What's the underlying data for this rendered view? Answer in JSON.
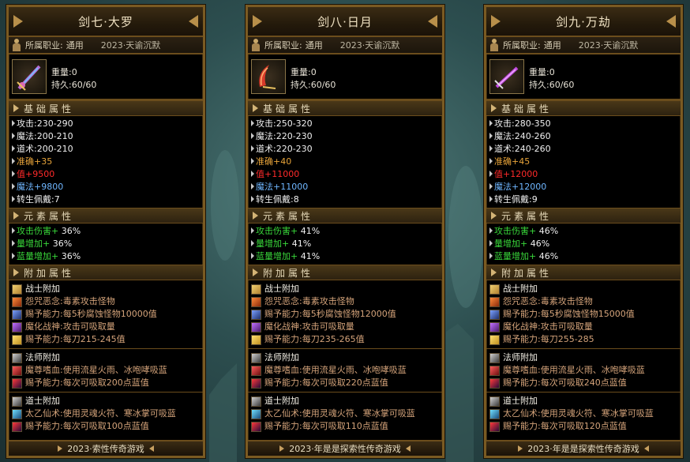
{
  "panels": [
    {
      "title": "剑七·大罗",
      "job_label": "所属职业:",
      "job_value": "通用",
      "season": "2023·天谕沉默",
      "weight": "重量:0",
      "durability": "持久:60/60",
      "sec_basic": "基础属性",
      "basic": [
        "攻击:230-290",
        "魔法:200-210",
        "道术:200-210"
      ],
      "accuracy": "准确+35",
      "hp": "值+9500",
      "mp_label": "魔法",
      "mp_value": "+9800",
      "reborn": "转生佩戴:7",
      "sec_element": "元素属性",
      "elements": [
        {
          "label": "攻击伤害+",
          "value": "36%"
        },
        {
          "label": "量增加+",
          "value": "36%"
        },
        {
          "label": "蓝量增加+",
          "value": "36%"
        }
      ],
      "sec_extra": "附加属性",
      "warrior": {
        "head": "战士附加",
        "lines": [
          "怨咒恶念:毒素攻击怪物",
          "赐予能力:每5秒腐蚀怪物10000值",
          "魔化战神:攻击可吸取量",
          "赐予能力:每刀215-245值"
        ]
      },
      "mage": {
        "head": "法师附加",
        "lines": [
          "魔尊嗜血:使用流星火雨、冰咆哮吸蓝",
          "赐予能力:每次可吸取200点蓝值"
        ]
      },
      "taoist": {
        "head": "道士附加",
        "lines": [
          "太乙仙术:使用灵魂火符、寒冰掌可吸蓝",
          "赐予能力:每次可吸取100点蓝值"
        ]
      },
      "footer": "2023·索性传奇游戏"
    },
    {
      "title": "剑八·日月",
      "job_label": "所属职业:",
      "job_value": "通用",
      "season": "2023·天谕沉默",
      "weight": "重量:0",
      "durability": "持久:60/60",
      "sec_basic": "基础属性",
      "basic": [
        "攻击:250-320",
        "魔法:220-230",
        "道术:220-230"
      ],
      "accuracy": "准确+40",
      "hp": "值+11000",
      "mp_label": "魔法",
      "mp_value": "+11000",
      "reborn": "转生佩戴:8",
      "sec_element": "元素属性",
      "elements": [
        {
          "label": "攻击伤害+",
          "value": "41%"
        },
        {
          "label": "量增加+",
          "value": "41%"
        },
        {
          "label": "蓝量增加+",
          "value": "41%"
        }
      ],
      "sec_extra": "附加属性",
      "warrior": {
        "head": "战士附加",
        "lines": [
          "怨咒恶念:毒素攻击怪物",
          "赐予能力:每5秒腐蚀怪物12000值",
          "魔化战神:攻击可吸取量",
          "赐予能力:每刀235-265值"
        ]
      },
      "mage": {
        "head": "法师附加",
        "lines": [
          "魔尊嗜血:使用流星火雨、冰咆哮吸蓝",
          "赐予能力:每次可吸取220点蓝值"
        ]
      },
      "taoist": {
        "head": "道士附加",
        "lines": [
          "太乙仙术:使用灵魂火符、寒冰掌可吸蓝",
          "赐予能力:每次可吸取110点蓝值"
        ]
      },
      "footer": "2023·年是是探索性传奇游戏"
    },
    {
      "title": "剑九·万劫",
      "job_label": "所属职业:",
      "job_value": "通用",
      "season": "2023·天谕沉默",
      "weight": "重量:0",
      "durability": "持久:60/60",
      "sec_basic": "基础属性",
      "basic": [
        "攻击:280-350",
        "魔法:240-260",
        "道术:240-260"
      ],
      "accuracy": "准确+45",
      "hp": "值+12000",
      "mp_label": "魔法",
      "mp_value": "+12000",
      "reborn": "转生佩戴:9",
      "sec_element": "元素属性",
      "elements": [
        {
          "label": "攻击伤害+",
          "value": "46%"
        },
        {
          "label": "量增加+",
          "value": "46%"
        },
        {
          "label": "蓝量增加+",
          "value": "46%"
        }
      ],
      "sec_extra": "附加属性",
      "warrior": {
        "head": "战士附加",
        "lines": [
          "怨咒恶念:毒素攻击怪物",
          "赐予能力:每5秒腐蚀怪物15000值",
          "魔化战神:攻击可吸取量",
          "赐予能力:每刀255-285"
        ]
      },
      "mage": {
        "head": "法师附加",
        "lines": [
          "魔尊嗜血:使用流星火雨、冰咆哮吸蓝",
          "赐予能力:每次可吸取240点蓝值"
        ]
      },
      "taoist": {
        "head": "道士附加",
        "lines": [
          "太乙仙术:使用灵魂火符、寒冰掌可吸蓝",
          "赐予能力:每次可吸取120点蓝值"
        ]
      },
      "footer": "2023·年是是探索性传奇游戏"
    }
  ],
  "icons": {
    "person": "person-icon",
    "weapons": [
      "purple-sword-icon",
      "red-scimitar-icon",
      "violet-blade-icon"
    ]
  }
}
